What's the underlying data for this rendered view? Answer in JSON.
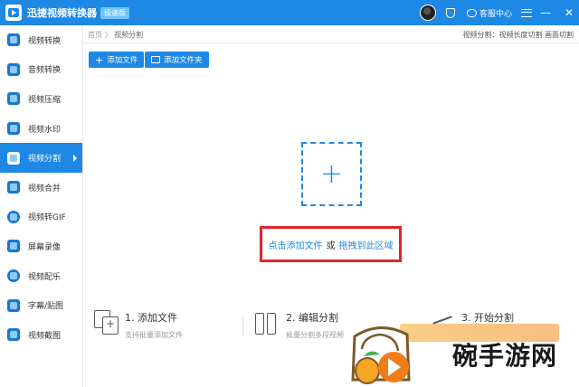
{
  "titlebar": {
    "title": "迅捷视频转换器",
    "edition": "极速版",
    "service_label": "客服中心",
    "minimize": "—",
    "close": "✕"
  },
  "sidebar": {
    "items": [
      {
        "label": "视频转换",
        "icon": "video-convert-icon"
      },
      {
        "label": "音频转换",
        "icon": "audio-convert-icon"
      },
      {
        "label": "视频压缩",
        "icon": "video-compress-icon"
      },
      {
        "label": "视频水印",
        "icon": "video-watermark-icon"
      },
      {
        "label": "视频分割",
        "icon": "video-split-icon",
        "active": true
      },
      {
        "label": "视频合并",
        "icon": "video-merge-icon"
      },
      {
        "label": "视频转GIF",
        "icon": "video-gif-icon"
      },
      {
        "label": "屏幕录像",
        "icon": "screen-record-icon"
      },
      {
        "label": "视频配乐",
        "icon": "video-music-icon"
      },
      {
        "label": "字幕/贴图",
        "icon": "subtitle-sticker-icon"
      },
      {
        "label": "视频截图",
        "icon": "video-screenshot-icon"
      }
    ]
  },
  "breadcrumb": {
    "home": "首页",
    "separator": "〉",
    "current": "视频分割"
  },
  "top_note": "视频分割：视频长度切割 画面切割",
  "toolbar": {
    "add_file": "添加文件",
    "add_folder": "添加文件夹"
  },
  "dropzone": {
    "plus": "+",
    "click_text": "点击添加文件",
    "or_text": "或",
    "drag_text": "拖拽到此区域"
  },
  "steps": [
    {
      "title": "1. 添加文件",
      "desc": "支持批量添加文件"
    },
    {
      "title": "2. 编辑分割",
      "desc": "批量分割多段视频"
    },
    {
      "title": "3. 开始分割",
      "desc": ""
    }
  ],
  "watermark": {
    "text": "碗手游网"
  },
  "colors": {
    "accent": "#1e88e5",
    "highlight_border": "#e0252b"
  }
}
